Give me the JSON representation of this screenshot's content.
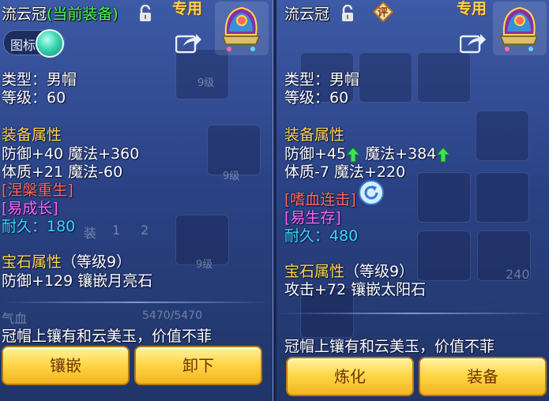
{
  "left": {
    "title_name": "流云冠",
    "title_status": "(当前装备)",
    "exclusive": "专用",
    "toggle_label": "图标",
    "type_line": "类型：男帽",
    "level_line": "等级：60",
    "attr_header": "装备属性",
    "attr_line1": "防御+40 魔法+360",
    "attr_line2": "体质+21 魔法-60",
    "special_skill": "[涅槃重生]",
    "special_effect": "[易成长]",
    "durability": "耐久：180",
    "gem_header": "宝石属性",
    "gem_level": "（等级9）",
    "gem_line": "防御+129 镶嵌月亮石",
    "desc": "冠帽上镶有和云美玉，价值不菲",
    "btn1": "镶嵌",
    "btn2": "卸下",
    "bg": {
      "level_tag1": "9级",
      "level_tag2": "9级",
      "level_tag3": "9级",
      "tab1": "装",
      "tab2": "1",
      "tab3": "2",
      "hp_label": "气血",
      "hp_value": "5470/5470"
    }
  },
  "right": {
    "title_name": "流云冠",
    "eval_badge": "评",
    "exclusive": "专用",
    "type_line": "类型：男帽",
    "level_line": "等级：60",
    "attr_header": "装备属性",
    "attr_line1a": "防御+45",
    "attr_line1b": "魔法+384",
    "attr_line2": "体质-7 魔法+220",
    "special_skill": "[嗜血连击]",
    "special_effect": "[易生存]",
    "durability": "耐久：480",
    "gem_header": "宝石属性",
    "gem_level": "（等级9）",
    "gem_line": "攻击+72 镶嵌太阳石",
    "desc": "冠帽上镶有和云美玉，价值不菲",
    "btn1": "炼化",
    "btn2": "装备",
    "bg": {
      "count": "240"
    }
  },
  "colors": {
    "section_header": "#ffd84a",
    "special_skill": "#ff6a5a",
    "special_effect": "#ff66ff",
    "durability": "#3ad9ff",
    "title_status": "#4dff4d",
    "button": "#ffd84a"
  },
  "icons": [
    "lock-icon",
    "share-icon",
    "item-helmet-icon",
    "toggle-knob-icon",
    "eval-badge-icon",
    "arrow-up-icon",
    "refresh-icon"
  ]
}
